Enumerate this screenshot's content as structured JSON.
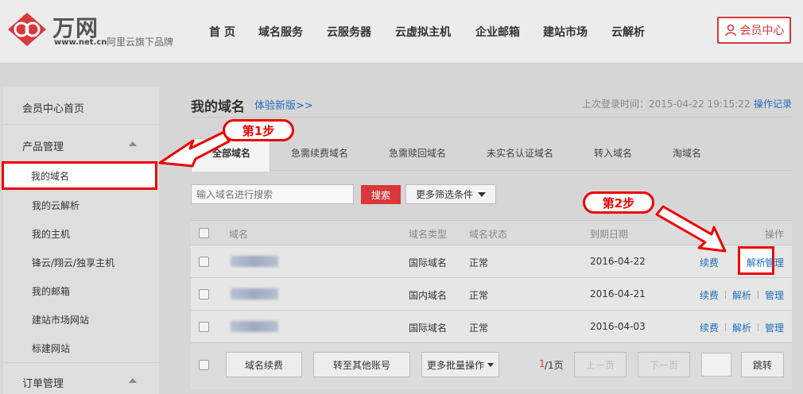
{
  "header": {
    "logo_cn": "万网",
    "logo_url": "www.net.cn",
    "logo_tag": "阿里云旗下品牌",
    "nav": [
      "首 页",
      "域名服务",
      "云服务器",
      "云虚拟主机",
      "企业邮箱",
      "建站市场",
      "云解析"
    ],
    "member_center": "会员中心"
  },
  "sidebar": {
    "home": "会员中心首页",
    "product_group": "产品管理",
    "items": [
      "我的域名",
      "我的云解析",
      "我的主机",
      "锋云/翔云/独享主机",
      "我的邮箱",
      "建站市场网站",
      "标建网站"
    ],
    "order_group": "订单管理"
  },
  "main": {
    "title": "我的域名",
    "new_version": "体验新版>>",
    "last_login": "上次登录时间：2015-04-22 19:15:22",
    "op_log": "操作记录",
    "tabs": [
      "全部域名",
      "急需续费域名",
      "急需赎回域名",
      "未实名认证域名",
      "转入域名",
      "淘域名"
    ],
    "search_placeholder": "输入域名进行搜索",
    "search_button": "搜索",
    "filter_button": "更多筛选条件",
    "columns": [
      "域名",
      "域名类型",
      "域名状态",
      "到期日期",
      "操作"
    ],
    "rows": [
      {
        "type": "国际域名",
        "status": "正常",
        "expiry": "2016-04-22"
      },
      {
        "type": "国内域名",
        "status": "正常",
        "expiry": "2016-04-21"
      },
      {
        "type": "国际域名",
        "status": "正常",
        "expiry": "2016-04-03"
      }
    ],
    "actions": {
      "renew": "续费",
      "resolve": "解析",
      "manage": "管理"
    },
    "footer": {
      "renew": "域名续费",
      "transfer": "转至其他账号",
      "batch": "更多批量操作",
      "page_current": "1",
      "page_total": "/1页",
      "prev": "上一页",
      "next": "下一页",
      "jump": "跳转"
    }
  },
  "annotations": {
    "step1": "第1步",
    "step2": "第2步"
  },
  "colors": {
    "accent": "#d9383c",
    "link": "#1f6dbf",
    "highlight": "#ee0000"
  }
}
